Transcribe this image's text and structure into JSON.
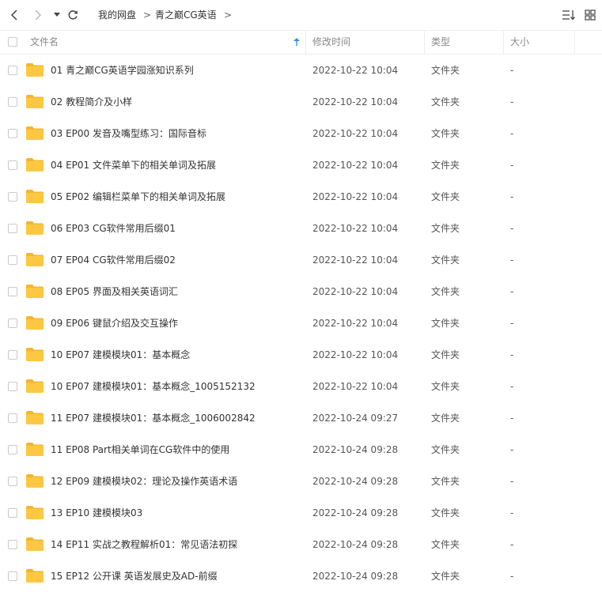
{
  "toolbar": {
    "back_icon": "chevron-left-icon",
    "forward_icon": "chevron-right-icon",
    "history_icon": "caret-down-icon",
    "refresh_icon": "refresh-icon",
    "sort_icon": "sort-list-icon",
    "grid_icon": "grid-view-icon"
  },
  "breadcrumb": {
    "items": [
      "我的网盘",
      "青之巅CG英语"
    ],
    "separator": ">"
  },
  "columns": {
    "name": "文件名",
    "modified": "修改时间",
    "type": "类型",
    "size": "大小",
    "sort_indicator": "arrow-up-icon"
  },
  "colors": {
    "folder": "#fcc842",
    "folder_tab": "#f7b52c",
    "sort_arrow": "#3b8ee8"
  },
  "files": [
    {
      "name": "01 青之巅CG英语学园涨知识系列",
      "modified": "2022-10-22 10:04",
      "type": "文件夹",
      "size": "-"
    },
    {
      "name": "02 教程简介及小样",
      "modified": "2022-10-22 10:04",
      "type": "文件夹",
      "size": "-"
    },
    {
      "name": "03 EP00 发音及嘴型练习：国际音标",
      "modified": "2022-10-22 10:04",
      "type": "文件夹",
      "size": "-"
    },
    {
      "name": "04 EP01 文件菜单下的相关单词及拓展",
      "modified": "2022-10-22 10:04",
      "type": "文件夹",
      "size": "-"
    },
    {
      "name": "05 EP02 编辑栏菜单下的相关单词及拓展",
      "modified": "2022-10-22 10:04",
      "type": "文件夹",
      "size": "-"
    },
    {
      "name": "06 EP03 CG软件常用后缀01",
      "modified": "2022-10-22 10:04",
      "type": "文件夹",
      "size": "-"
    },
    {
      "name": "07 EP04 CG软件常用后缀02",
      "modified": "2022-10-22 10:04",
      "type": "文件夹",
      "size": "-"
    },
    {
      "name": "08 EP05 界面及相关英语词汇",
      "modified": "2022-10-22 10:04",
      "type": "文件夹",
      "size": "-"
    },
    {
      "name": "09 EP06 键鼠介绍及交互操作",
      "modified": "2022-10-22 10:04",
      "type": "文件夹",
      "size": "-"
    },
    {
      "name": "10 EP07 建模模块01：基本概念",
      "modified": "2022-10-22 10:04",
      "type": "文件夹",
      "size": "-"
    },
    {
      "name": "10 EP07 建模模块01：基本概念_1005152132",
      "modified": "2022-10-22 10:04",
      "type": "文件夹",
      "size": "-"
    },
    {
      "name": "11 EP07 建模模块01：基本概念_1006002842",
      "modified": "2022-10-24 09:27",
      "type": "文件夹",
      "size": "-"
    },
    {
      "name": "11 EP08 Part相关单词在CG软件中的使用",
      "modified": "2022-10-24 09:28",
      "type": "文件夹",
      "size": "-"
    },
    {
      "name": "12 EP09 建模模块02：理论及操作英语术语",
      "modified": "2022-10-24 09:28",
      "type": "文件夹",
      "size": "-"
    },
    {
      "name": "13 EP10 建模模块03",
      "modified": "2022-10-24 09:28",
      "type": "文件夹",
      "size": "-"
    },
    {
      "name": "14 EP11 实战之教程解析01：常见语法初探",
      "modified": "2022-10-24 09:28",
      "type": "文件夹",
      "size": "-"
    },
    {
      "name": "15 EP12 公开课 英语发展史及AD-前缀",
      "modified": "2022-10-24 09:28",
      "type": "文件夹",
      "size": "-"
    }
  ]
}
